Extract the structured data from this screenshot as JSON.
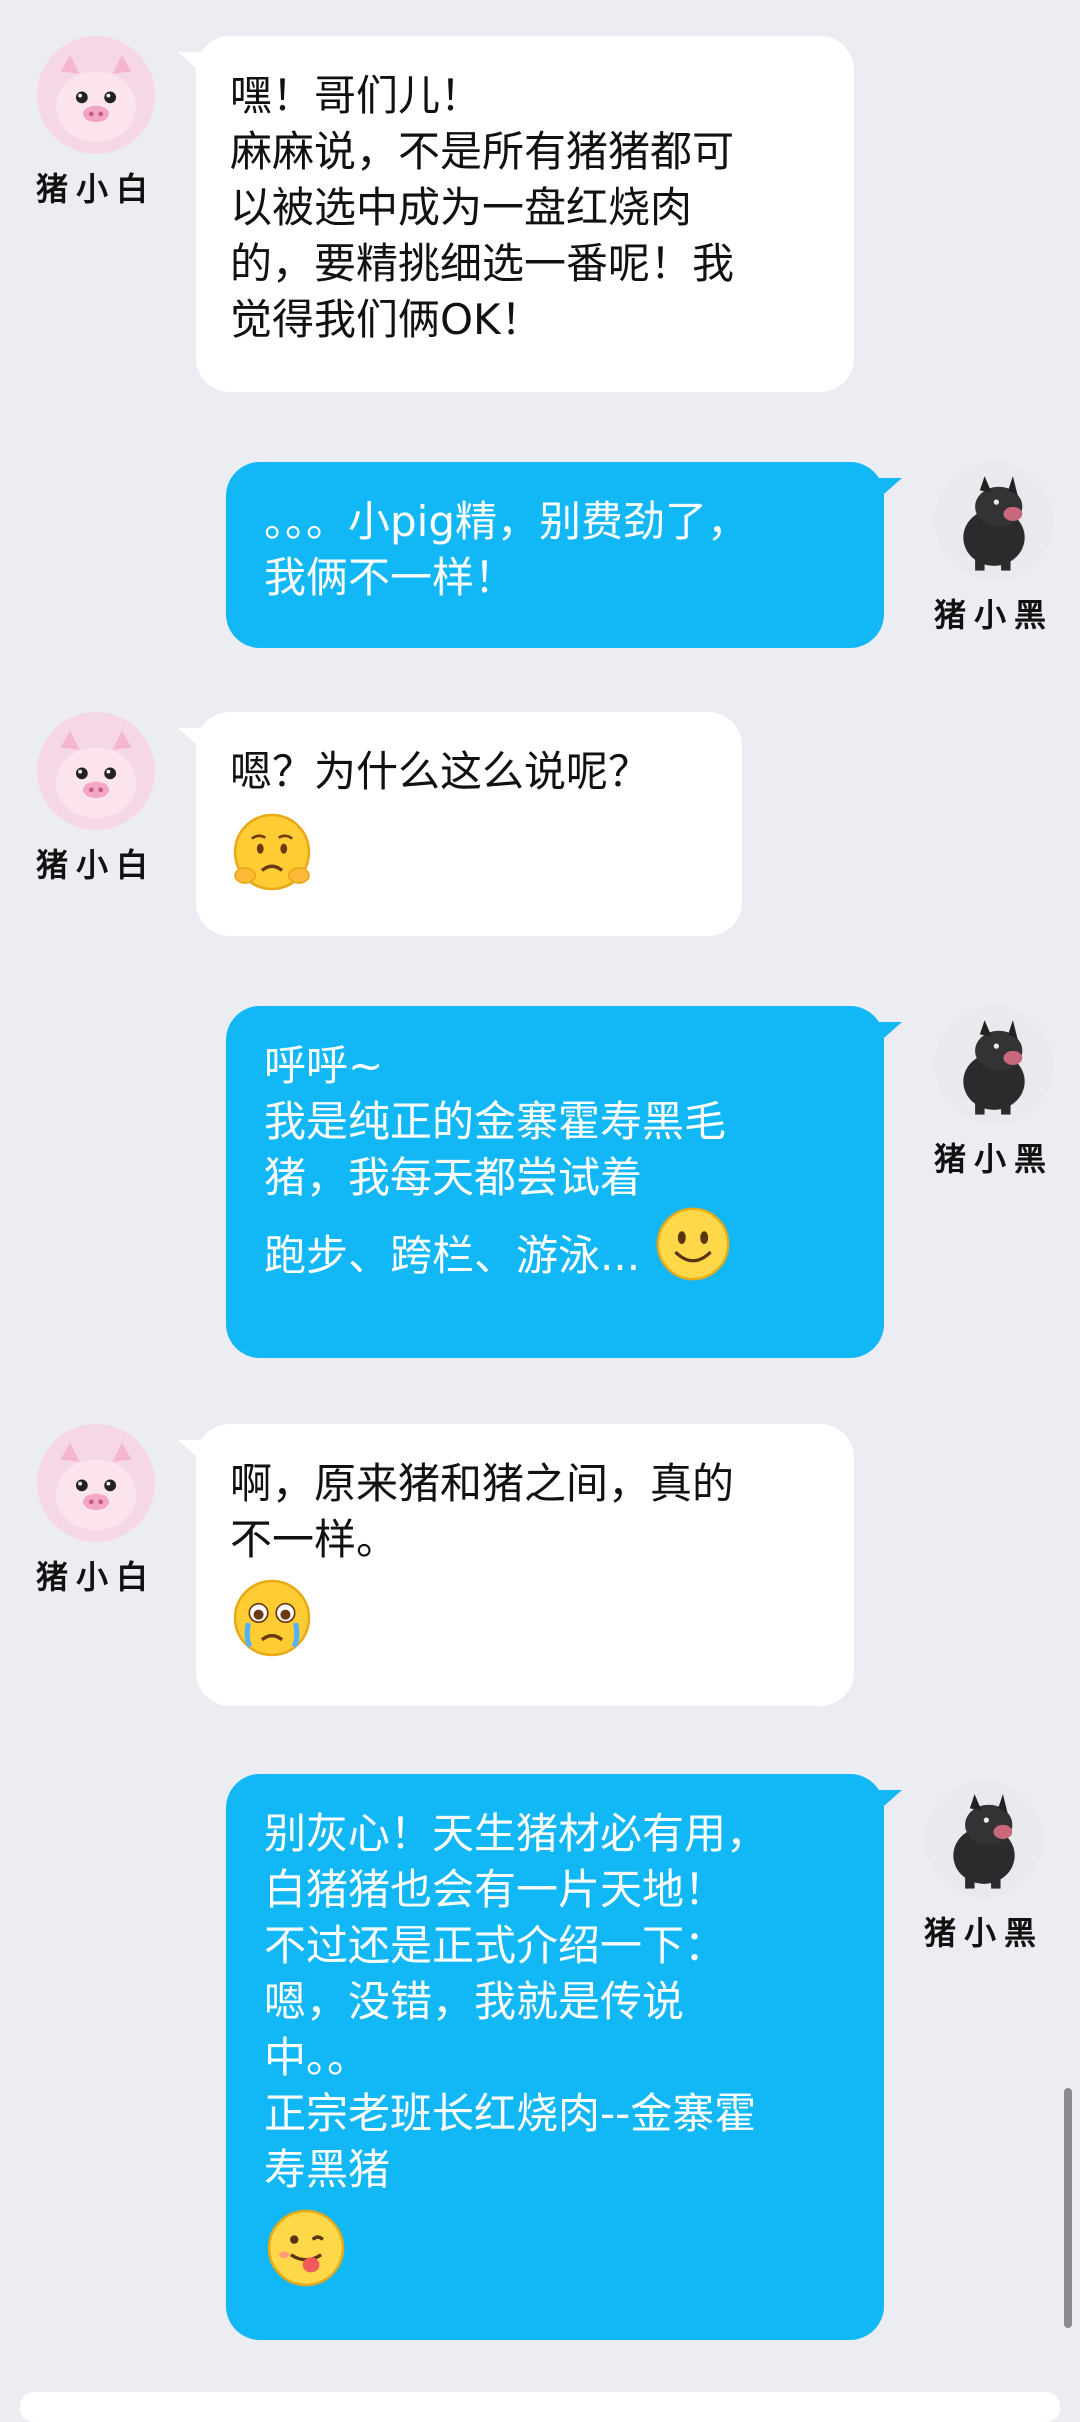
{
  "contacts": {
    "white_pig": {
      "name": "猪小白",
      "avatar_icon": "white-pig-avatar-icon"
    },
    "black_pig": {
      "name": "猪小黑",
      "avatar_icon": "black-pig-avatar-icon"
    }
  },
  "colors": {
    "background": "#ecedf3",
    "incoming_bubble": "#ffffff",
    "outgoing_bubble": "#12b7f5",
    "outgoing_text": "#ffffff"
  },
  "messages": [
    {
      "sender": "猪小白",
      "lines": [
        "嘿！哥们儿！",
        "麻麻说，不是所有猪猪都可",
        "以被选中成为一盘红烧肉",
        "的，要精挑细选一番呢！我",
        "觉得我们俩OK！"
      ]
    },
    {
      "sender": "猪小黑",
      "lines": [
        "。。。小pig精，别费劲了，",
        "我俩不一样！"
      ]
    },
    {
      "sender": "猪小白",
      "lines": [
        "嗯？为什么这么说呢？"
      ],
      "emoji": "worried-face-emoji"
    },
    {
      "sender": "猪小黑",
      "lines": [
        "呼呼~",
        "我是纯正的金寨霍寿黑毛",
        "猪，我每天都尝试着",
        "跑步、跨栏、游泳..."
      ],
      "emoji": "smiling-face-emoji"
    },
    {
      "sender": "猪小白",
      "lines": [
        "啊，原来猪和猪之间，真的",
        "不一样。"
      ],
      "emoji": "crying-face-emoji"
    },
    {
      "sender": "猪小黑",
      "lines": [
        "别灰心！天生猪材必有用，",
        "白猪猪也会有一片天地！",
        "不过还是正式介绍一下：",
        "嗯，没错，我就是传说",
        "中。。",
        "正宗老班长红烧肉--金寨霍",
        "寿黑猪"
      ],
      "emoji": "tongue-out-face-emoji"
    }
  ]
}
